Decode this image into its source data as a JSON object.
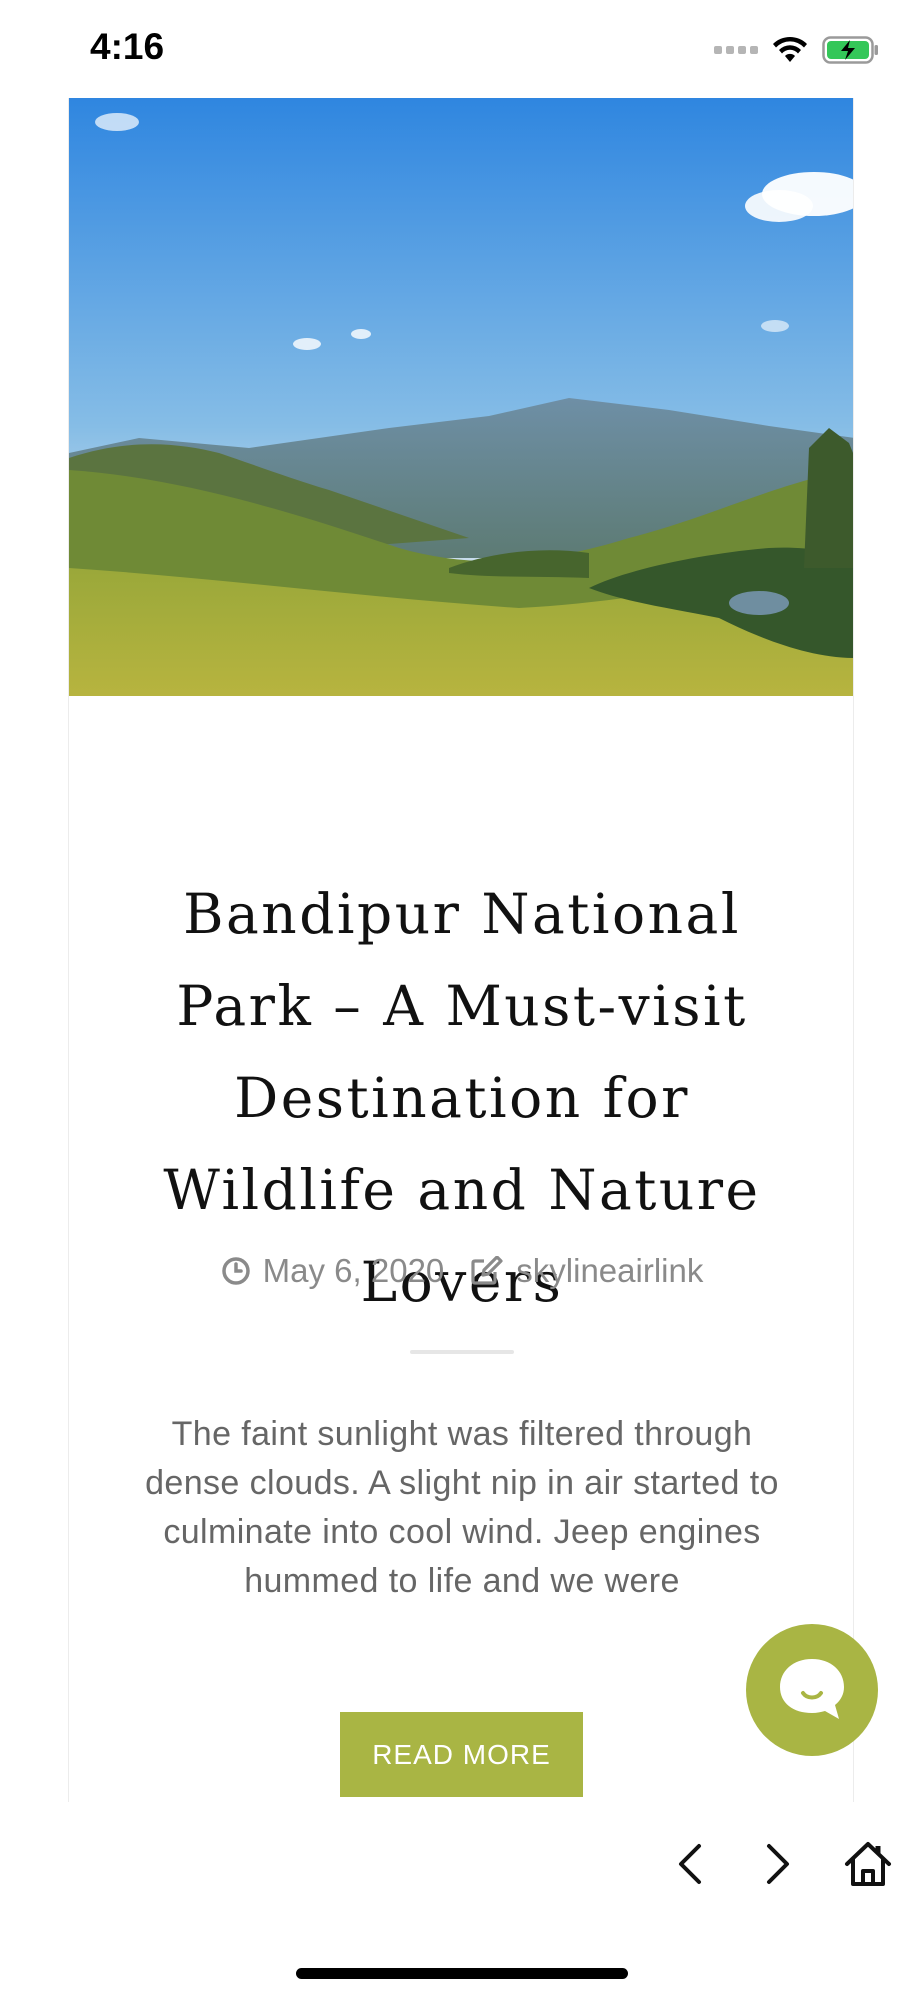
{
  "status_bar": {
    "time": "4:16"
  },
  "post": {
    "title": "Bandipur National Park – A Must-visit Destination for Wildlife and Nature Lovers",
    "date": "May 6, 2020",
    "author": "skylineairlink",
    "excerpt": "The faint sunlight was filtered through dense clouds. A slight nip in air started to culminate into cool wind. Jeep engines hummed to life and we were",
    "read_more_label": "READ MORE"
  },
  "icons": {
    "date": "clock-icon",
    "author": "edit-icon",
    "chat": "chat-bubble-icon",
    "back": "chevron-left-icon",
    "forward": "chevron-right-icon",
    "home": "home-icon"
  },
  "colors": {
    "accent": "#a9b544",
    "title": "#111111",
    "meta": "#8a8a8a",
    "excerpt": "#666666"
  }
}
